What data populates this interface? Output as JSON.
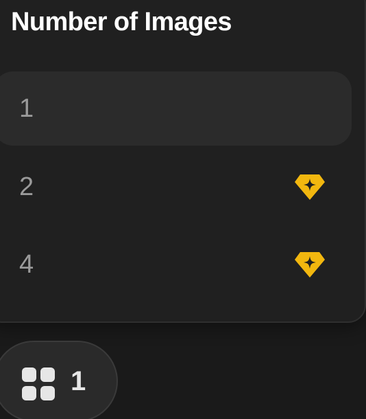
{
  "dropdown": {
    "title": "Number of Images",
    "options": [
      {
        "label": "1",
        "selected": true,
        "premium": false
      },
      {
        "label": "2",
        "selected": false,
        "premium": true
      },
      {
        "label": "4",
        "selected": false,
        "premium": true
      }
    ],
    "premium_icon": "premium-gem-icon",
    "premium_color": "#f2b70f"
  },
  "count_button": {
    "icon": "grid-icon",
    "value": "1"
  },
  "colors": {
    "background": "#1a1a1a",
    "panel": "#202020",
    "selected_row": "#2b2b2b",
    "title_text": "#ffffff",
    "option_text": "#9a9a9a",
    "pill": "#2a2a2a"
  }
}
